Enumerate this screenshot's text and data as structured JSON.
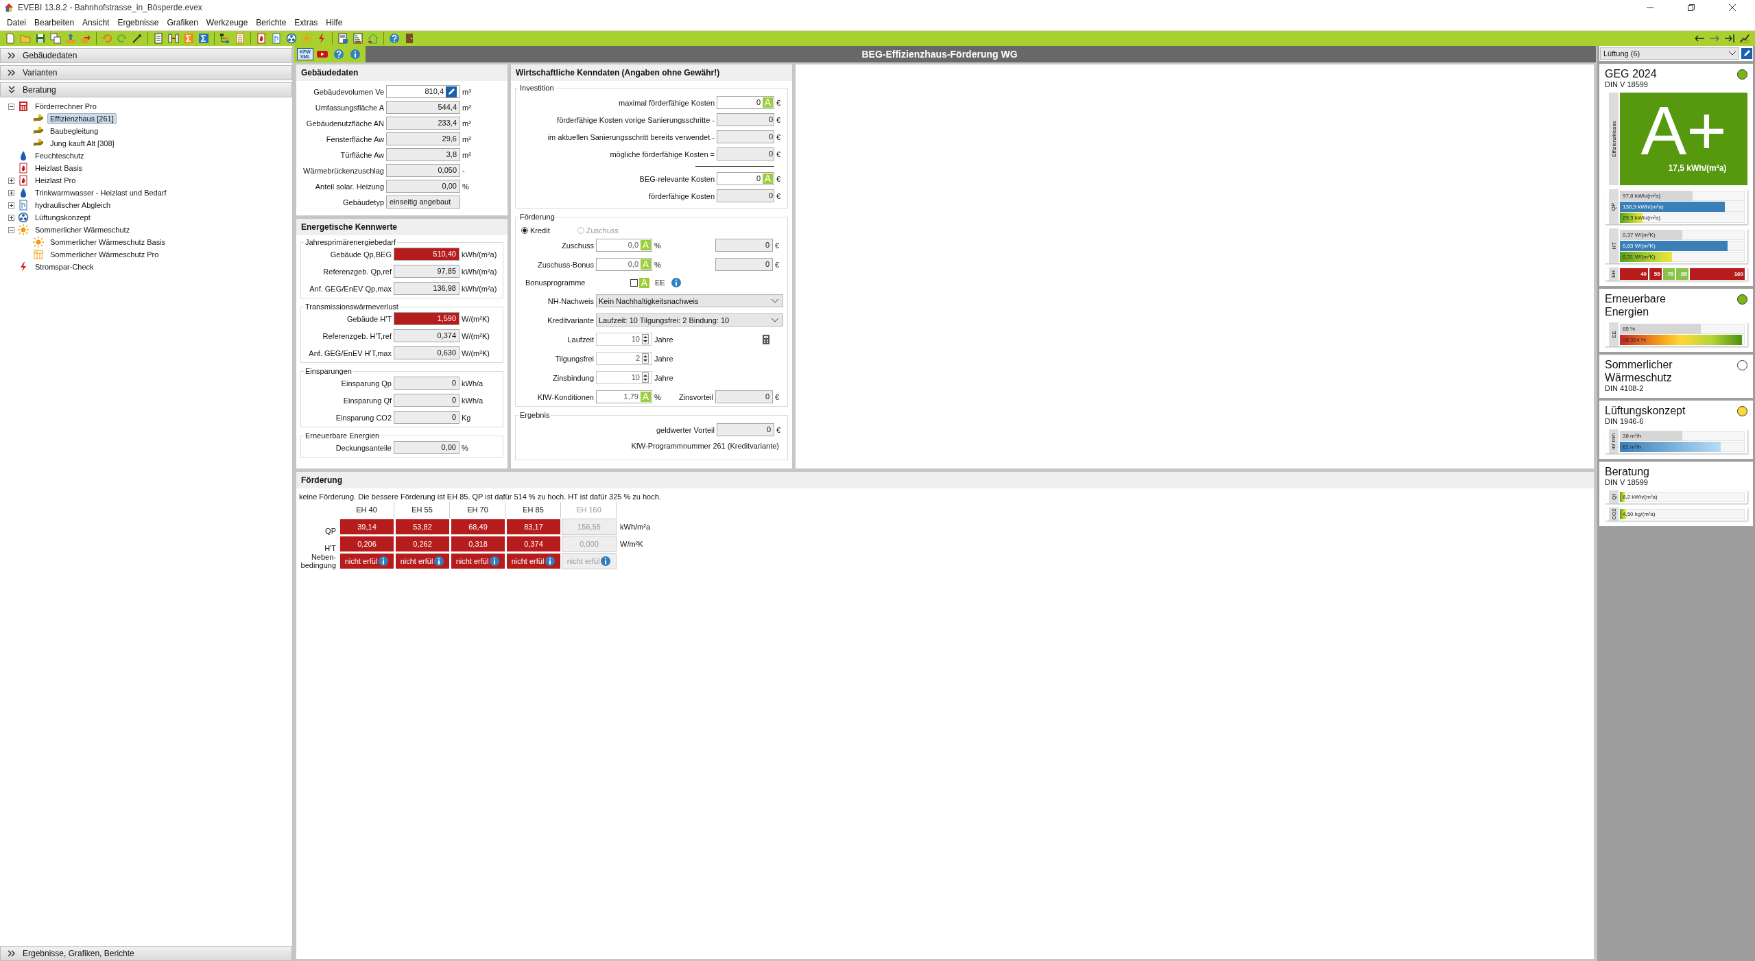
{
  "window": {
    "title": "EVEBI 13.8.2 - Bahnhofstrasse_in_Bösperde.evex"
  },
  "menu": [
    "Datei",
    "Bearbeiten",
    "Ansicht",
    "Ergebnisse",
    "Grafiken",
    "Werkzeuge",
    "Berichte",
    "Extras",
    "Hilfe"
  ],
  "sidebar": {
    "sections": [
      {
        "label": "Gebäudedaten",
        "expanded": false
      },
      {
        "label": "Varianten",
        "expanded": false
      },
      {
        "label": "Beratung",
        "expanded": true
      }
    ],
    "tree": [
      {
        "label": "Förderrechner Pro",
        "kind": "calculator",
        "expanded": true,
        "selected": false,
        "children": [
          {
            "label": "Effizienzhaus [261]",
            "kind": "hand",
            "selected": true
          },
          {
            "label": "Baubegleitung",
            "kind": "hand",
            "selected": false
          },
          {
            "label": "Jung kauft Alt [308]",
            "kind": "hand",
            "selected": false
          }
        ]
      },
      {
        "label": "Feuchteschutz",
        "kind": "drop",
        "selected": false
      },
      {
        "label": "Heizlast Basis",
        "kind": "flame",
        "selected": false
      },
      {
        "label": "Heizlast Pro",
        "kind": "flame",
        "expanded": false,
        "selected": false
      },
      {
        "label": "Trinkwarmwasser - Heizlast und Bedarf",
        "kind": "drop",
        "expanded": false,
        "selected": false
      },
      {
        "label": "hydraulischer Abgleich",
        "kind": "document",
        "expanded": false,
        "selected": false
      },
      {
        "label": "Lüftungskonzept",
        "kind": "fan",
        "expanded": false,
        "selected": false
      },
      {
        "label": "Sommerlicher Wärmeschutz",
        "kind": "sun",
        "expanded": true,
        "selected": false,
        "children": [
          {
            "label": "Sommerlicher Wärmeschutz Basis",
            "kind": "sun",
            "selected": false
          },
          {
            "label": "Sommerlicher Wärmeschutz Pro",
            "kind": "grid",
            "selected": false
          }
        ]
      },
      {
        "label": "Stromspar-Check",
        "kind": "bolt",
        "selected": false
      }
    ],
    "bottom_section": {
      "label": "Ergebnisse, Grafiken, Berichte",
      "expanded": false
    }
  },
  "main": {
    "xml_button": "KFW XML",
    "title": "BEG-Effizienzhaus-Förderung WG",
    "building": {
      "title": "Gebäudedaten",
      "rows": [
        {
          "label": "Gebäudevolumen Ve",
          "value": "810,4",
          "unit": "m³",
          "editable": true,
          "kind": "number"
        },
        {
          "label": "Umfassungsfläche A",
          "value": "544,4",
          "unit": "m²",
          "editable": false,
          "kind": "number"
        },
        {
          "label": "Gebäudenutzfläche AN",
          "value": "233,4",
          "unit": "m²",
          "editable": false,
          "kind": "number"
        },
        {
          "label": "Fensterfläche Aw",
          "value": "29,6",
          "unit": "m²",
          "editable": false,
          "kind": "number"
        },
        {
          "label": "Türfläche Aw",
          "value": "3,8",
          "unit": "m²",
          "editable": false,
          "kind": "number"
        },
        {
          "label": "Wärmebrückenzuschlag",
          "value": "0,050",
          "unit": "-",
          "editable": false,
          "kind": "number"
        },
        {
          "label": "Anteil solar. Heizung",
          "value": "0,00",
          "unit": "%",
          "editable": false,
          "kind": "number"
        },
        {
          "label": "Gebäudetyp",
          "value": "einseitig angebaut",
          "editable": false,
          "kind": "text"
        }
      ]
    },
    "energy": {
      "title": "Energetische Kennwerte",
      "groups": [
        {
          "title": "Jahresprimärenergiebedarf",
          "rows": [
            {
              "label": "Gebäude Qp,BEG",
              "value": "510,40",
              "unit": "kWh/(m²a)",
              "alert": true
            },
            {
              "label": "Referenzgeb. Qp,ref",
              "value": "97,85",
              "unit": "kWh/(m²a)",
              "alert": false
            },
            {
              "label": "Anf. GEG/EnEV Qp,max",
              "value": "136,98",
              "unit": "kWh/(m²a)",
              "alert": false
            }
          ]
        },
        {
          "title": "Transmissionswärmeverlust",
          "rows": [
            {
              "label": "Gebäude H'T",
              "value": "1,590",
              "unit": "W/(m²K)",
              "alert": true
            },
            {
              "label": "Referenzgeb. H'T,ref",
              "value": "0,374",
              "unit": "W/(m²K)",
              "alert": false
            },
            {
              "label": "Anf. GEG/EnEV H'T,max",
              "value": "0,630",
              "unit": "W/(m²K)",
              "alert": false
            }
          ]
        },
        {
          "title": "Einsparungen",
          "rows": [
            {
              "label": "Einsparung Qp",
              "value": "0",
              "unit": "kWh/a",
              "alert": false
            },
            {
              "label": "Einsparung Qf",
              "value": "0",
              "unit": "kWh/a",
              "alert": false
            },
            {
              "label": "Einsparung CO2",
              "value": "0",
              "unit": "Kg",
              "alert": false
            }
          ]
        },
        {
          "title": "Erneuerbare Energien",
          "rows": [
            {
              "label": "Deckungsanteile",
              "value": "0,00",
              "unit": "%",
              "alert": false
            }
          ]
        }
      ]
    },
    "economics": {
      "title": "Wirtschaftliche Kenndaten (Angaben ohne Gewähr!)",
      "investment": {
        "title": "Investition",
        "rows": [
          {
            "label": "maximal förderfähige Kosten",
            "value": "0",
            "unit": "€",
            "auto": "A"
          },
          {
            "label": "förderfähige Kosten vorige Sanierungsschritte -",
            "value": "0",
            "unit": "€"
          },
          {
            "label": "im aktuellen Sanierungsschritt bereits verwendet -",
            "value": "0",
            "unit": "€"
          },
          {
            "label": "mögliche förderfähige Kosten =",
            "value": "0",
            "unit": "€"
          }
        ],
        "totals": [
          {
            "label": "BEG-relevante Kosten",
            "value": "0",
            "unit": "€",
            "auto": "A"
          },
          {
            "label": "förderfähige Kosten",
            "value": "0",
            "unit": "€"
          }
        ]
      },
      "funding": {
        "title": "Förderung",
        "types": [
          {
            "label": "Kredit",
            "selected": true,
            "disabled": false
          },
          {
            "label": "Zuschuss",
            "selected": false,
            "disabled": true
          }
        ],
        "grants": [
          {
            "label": "Zuschuss",
            "value": "0,0",
            "auto": "A",
            "unit": "%",
            "amount": "0",
            "currency": "€"
          },
          {
            "label": "Zuschuss-Bonus",
            "value": "0,0",
            "auto": "A",
            "unit": "%",
            "amount": "0",
            "currency": "€"
          }
        ],
        "bonus": {
          "label": "Bonusprogramme",
          "checked": false,
          "auto": "A",
          "option": "EE"
        },
        "selects": [
          {
            "label": "NH-Nachweis",
            "value": "Kein Nachhaltigkeitsnachweis"
          },
          {
            "label": "Kreditvariante",
            "value": "Laufzeit: 10 Tilgungsfrei: 2 Bindung: 10"
          }
        ],
        "spinners": [
          {
            "label": "Laufzeit",
            "value": "10",
            "unit": "Jahre"
          },
          {
            "label": "Tilgungsfrei",
            "value": "2",
            "unit": "Jahre"
          },
          {
            "label": "Zinsbindung",
            "value": "10",
            "unit": "Jahre"
          }
        ],
        "conditions": {
          "label": "KfW-Konditionen",
          "value": "1,79",
          "auto": "A",
          "unit": "%",
          "benefit_label": "Zinsvorteil",
          "benefit_value": "0",
          "currency": "€"
        }
      },
      "result": {
        "title": "Ergebnis",
        "label": "geldwerter Vorteil",
        "value": "0",
        "unit": "€",
        "program": "KfW-Programmnummer 261 (Kreditvariante)"
      }
    },
    "funding_table": {
      "title": "Förderung",
      "message": "keine Förderung. Die bessere Förderung ist EH 85. QP ist dafür 514 % zu hoch. HT ist dafür 325 % zu hoch.",
      "columns": [
        {
          "label": "EH 40",
          "disabled": false
        },
        {
          "label": "EH 55",
          "disabled": false
        },
        {
          "label": "EH 70",
          "disabled": false
        },
        {
          "label": "EH 85",
          "disabled": false
        },
        {
          "label": "EH 160",
          "disabled": true
        }
      ],
      "rows": [
        {
          "label": "QP",
          "unit": "kWh/m²a",
          "kind": "value",
          "cells": [
            {
              "value": "39,14",
              "failed": true
            },
            {
              "value": "53,82",
              "failed": true
            },
            {
              "value": "68,49",
              "failed": true
            },
            {
              "value": "83,17",
              "failed": true
            },
            {
              "value": "156,55",
              "failed": false
            }
          ]
        },
        {
          "label": "H'T",
          "unit": "W/m²K",
          "kind": "value",
          "cells": [
            {
              "value": "0,206",
              "failed": true
            },
            {
              "value": "0,262",
              "failed": true
            },
            {
              "value": "0,318",
              "failed": true
            },
            {
              "value": "0,374",
              "failed": true
            },
            {
              "value": "0,000",
              "failed": false
            }
          ]
        },
        {
          "label": "Neben-bedingung",
          "kind": "condition",
          "cells": [
            {
              "value": "nicht erfül",
              "failed": true
            },
            {
              "value": "nicht erfül",
              "failed": true
            },
            {
              "value": "nicht erfül",
              "failed": true
            },
            {
              "value": "nicht erfül",
              "failed": true
            },
            {
              "value": "nicht erfül",
              "failed": false
            }
          ]
        }
      ]
    }
  },
  "right_panel": {
    "dropdown": "Lüftung (6)",
    "cards": [
      {
        "title": "GEG 2024",
        "subtitle": "DIN V 18599",
        "color": "#7cb518",
        "energy_class": {
          "axis": "Effizienzklasse",
          "class": "A+",
          "value": "17,5 kWh/(m²a)"
        },
        "groups": [
          {
            "label": "QP",
            "bars": [
              {
                "text": "97,8 kWh/(m²a)",
                "level": 0.58,
                "kind": "reference"
              },
              {
                "text": "136,9 kWh/(m²a)",
                "level": 0.84,
                "kind": "limit"
              },
              {
                "text": "29,3 kWh/(m²a)",
                "level": 0.18,
                "kind": "actual"
              }
            ]
          },
          {
            "label": "HT",
            "bars": [
              {
                "text": "0,37 W/(m²K)",
                "level": 0.5,
                "kind": "reference"
              },
              {
                "text": "0,63 W/(m²K)",
                "level": 0.86,
                "kind": "limit"
              },
              {
                "text": "0,31 W/(m²K)",
                "level": 0.42,
                "kind": "actual"
              }
            ]
          }
        ],
        "scale": {
          "label": "EH",
          "segments": [
            {
              "label": "40",
              "color": "#b71c1c"
            },
            {
              "label": "55",
              "color": "#b71c1c"
            },
            {
              "label": "70",
              "color": "#8bc34a"
            },
            {
              "label": "85",
              "color": "#8bc34a"
            },
            {
              "label": "160",
              "color": "#b71c1c"
            }
          ]
        }
      },
      {
        "title": "Erneuerbare Energien",
        "color": "#7cb518",
        "groups": [
          {
            "label": "EE",
            "bars": [
              {
                "text": "65 %",
                "level": 0.65,
                "kind": "reference"
              },
              {
                "text": "98,314 %",
                "level": 0.98,
                "kind": "spectrum"
              }
            ]
          }
        ]
      },
      {
        "title": "Sommerlicher Wärmeschutz",
        "subtitle": "DIN 4108-2",
        "color": "#ffffff"
      },
      {
        "title": "Lüftungskonzept",
        "subtitle": "DIN 1946-6",
        "color": "#fdd835",
        "groups": [
          {
            "label": "inf min",
            "bars": [
              {
                "text": "38 m³/h",
                "level": 0.5,
                "kind": "reference"
              },
              {
                "text": "61 m³/h",
                "level": 0.81,
                "kind": "light"
              }
            ]
          }
        ]
      },
      {
        "title": "Beratung",
        "subtitle": "DIN V 18599",
        "groups": [
          {
            "label": "Qf",
            "bars": [
              {
                "text": "8,2 kWh/(m²a)",
                "level": 0.04,
                "kind": "actual"
              }
            ]
          },
          {
            "label": "CO2",
            "bars": [
              {
                "text": "4,50 kg/(m²a)",
                "level": 0.05,
                "kind": "actual"
              }
            ]
          }
        ]
      }
    ]
  }
}
